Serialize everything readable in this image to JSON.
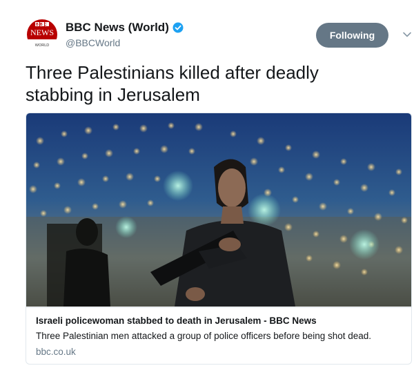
{
  "tweet": {
    "display_name": "BBC News (World)",
    "handle": "@BBCWorld",
    "follow_label": "Following",
    "text": "Three Palestinians killed after deadly stabbing in Jerusalem",
    "avatar": {
      "line1": "BBC",
      "line2": "NEWS",
      "line3": "WORLD"
    }
  },
  "card": {
    "title": "Israeli policewoman stabbed to death in Jerusalem - BBC News",
    "description": "Three Palestinian men attacked a group of police officers before being shot dead.",
    "domain": "bbc.co.uk"
  },
  "colors": {
    "follow_bg": "#657786",
    "brand_red": "#b80000",
    "verified_blue": "#1da1f2"
  },
  "icons": {
    "verified": "verified-badge-icon",
    "caret": "chevron-down-icon"
  }
}
